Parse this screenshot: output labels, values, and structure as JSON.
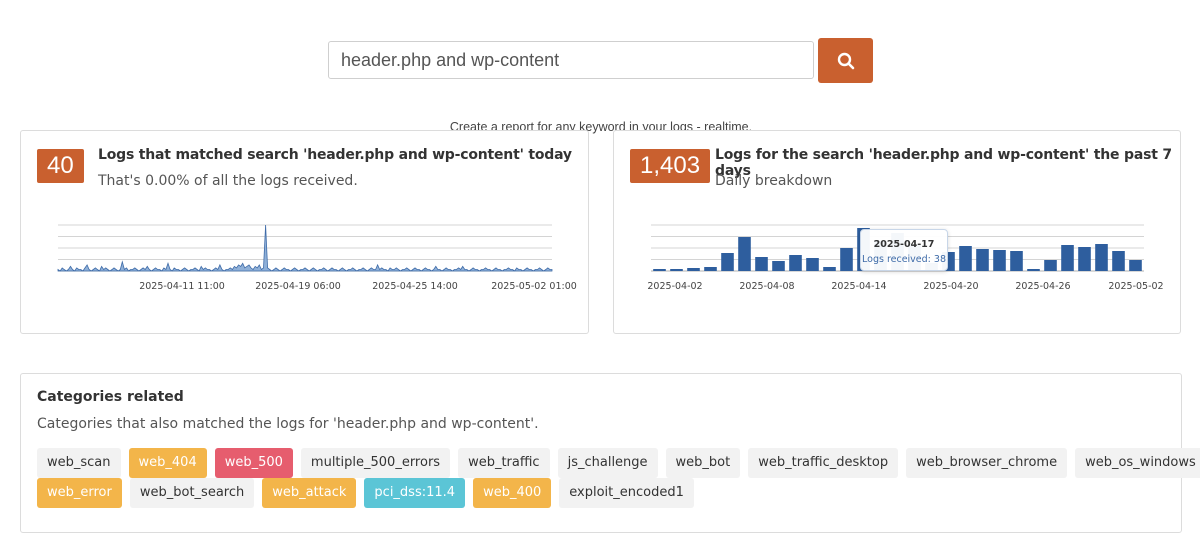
{
  "search": {
    "value": "header.php and wp-content",
    "button_icon": "search-icon",
    "caption": "Create a report for any keyword in your logs - realtime.",
    "accent": "#c9602f"
  },
  "today_card": {
    "count": "40",
    "title": "Logs that matched search 'header.php and wp-content' today",
    "subtitle": "That's 0.00% of all the logs received."
  },
  "week_card": {
    "count": "1,403",
    "title": "Logs for the search 'header.php and wp-content' the past 7 days",
    "subtitle": "Daily breakdown",
    "tooltip": {
      "date": "2025-04-17",
      "text": "Logs received: 38"
    }
  },
  "categories": {
    "title": "Categories related",
    "subtitle": "Categories that also matched the logs for 'header.php and wp-content'.",
    "rows": [
      [
        {
          "label": "web_scan",
          "style": "default"
        },
        {
          "label": "web_404",
          "style": "warning"
        },
        {
          "label": "web_500",
          "style": "danger"
        },
        {
          "label": "multiple_500_errors",
          "style": "default"
        },
        {
          "label": "web_traffic",
          "style": "default"
        },
        {
          "label": "js_challenge",
          "style": "default"
        },
        {
          "label": "web_bot",
          "style": "default"
        },
        {
          "label": "web_traffic_desktop",
          "style": "default"
        },
        {
          "label": "web_browser_chrome",
          "style": "default"
        },
        {
          "label": "web_os_windows",
          "style": "default"
        }
      ],
      [
        {
          "label": "web_error",
          "style": "warning"
        },
        {
          "label": "web_bot_search",
          "style": "default"
        },
        {
          "label": "web_attack",
          "style": "warning"
        },
        {
          "label": "pci_dss:11.4",
          "style": "info"
        },
        {
          "label": "web_400",
          "style": "warning"
        },
        {
          "label": "exploit_encoded1",
          "style": "default"
        }
      ]
    ],
    "colors": {
      "warning": "#f3b54a",
      "danger": "#e65d6e",
      "info": "#5bc5d6",
      "default": "#f2f2f2"
    }
  },
  "chart_data": [
    {
      "type": "area",
      "x_tick_labels": [
        "2025-04-11 11:00",
        "2025-04-19 06:00",
        "2025-04-25 14:00",
        "2025-05-02 01:00"
      ],
      "series": [
        {
          "color": "#3e6ba8",
          "values": [
            1,
            0,
            2,
            1,
            0,
            1,
            3,
            1,
            0,
            2,
            1,
            1,
            0,
            2,
            4,
            1,
            0,
            1,
            2,
            1,
            0,
            3,
            1,
            2,
            1,
            0,
            1,
            2,
            1,
            0,
            1,
            6,
            1,
            2,
            0,
            1,
            1,
            2,
            1,
            0,
            1,
            2,
            1,
            3,
            1,
            0,
            1,
            2,
            1,
            1,
            0,
            2,
            1,
            5,
            1,
            0,
            2,
            1,
            1,
            0,
            1,
            2,
            1,
            0,
            1,
            1,
            2,
            1,
            0,
            3,
            1,
            2,
            1,
            1,
            0,
            1,
            2,
            1,
            4,
            1,
            0,
            1,
            1,
            2,
            1,
            3,
            2,
            4,
            3,
            5,
            2,
            3,
            4,
            2,
            1,
            3,
            2,
            4,
            1,
            2,
            30,
            2,
            1,
            0,
            1,
            2,
            1,
            0,
            1,
            2,
            1,
            1,
            0,
            1,
            2,
            1,
            0,
            1,
            1,
            2,
            1,
            0,
            1,
            2,
            1,
            0,
            1,
            1,
            2,
            1,
            0,
            1,
            2,
            1,
            1,
            0,
            1,
            2,
            1,
            0,
            1,
            1,
            2,
            1,
            0,
            1,
            1,
            2,
            1,
            0,
            1,
            2,
            1,
            1,
            4,
            1,
            2,
            1,
            1,
            0,
            2,
            1,
            1,
            2,
            1,
            0,
            1,
            1,
            2,
            1,
            0,
            1,
            2,
            1,
            1,
            0,
            1,
            2,
            1,
            1,
            0,
            1,
            3,
            1,
            1,
            0,
            1,
            2,
            1,
            1,
            0,
            1,
            1,
            2,
            1,
            3,
            1,
            1,
            0,
            1,
            2,
            1,
            1,
            0,
            1,
            1,
            2,
            1,
            1,
            0,
            1,
            2,
            1,
            1,
            0,
            1,
            1,
            2,
            1,
            1,
            0,
            2,
            1,
            1,
            0,
            1,
            2,
            1,
            1,
            0,
            1,
            1,
            2,
            1,
            0,
            1,
            2,
            1,
            1
          ]
        }
      ],
      "grid": true
    },
    {
      "type": "bar",
      "x_tick_labels": [
        "2025-04-02",
        "2025-04-08",
        "2025-04-14",
        "2025-04-20",
        "2025-04-26",
        "2025-05-02"
      ],
      "series": [
        {
          "color": "#2e5e9e",
          "values": [
            2,
            2,
            3,
            4,
            18,
            34,
            14,
            10,
            16,
            13,
            4,
            23,
            43,
            30,
            38,
            27,
            8,
            19,
            25,
            22,
            21,
            20,
            2,
            11,
            26,
            24,
            27,
            20,
            11
          ]
        }
      ],
      "highlight": {
        "date": "2025-04-17",
        "value": 38
      },
      "grid": true
    }
  ]
}
